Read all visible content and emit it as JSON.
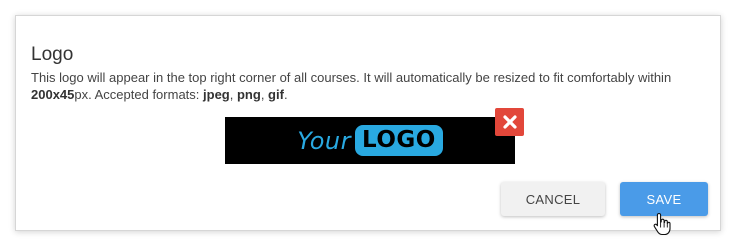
{
  "logo_section": {
    "title": "Logo",
    "description_part1": "This logo will appear in the top right corner of all courses. It will automatically be resized to fit comfortably within ",
    "dimensions": "200x45",
    "description_part2": "px. Accepted formats: ",
    "format_jpeg": "jpeg",
    "sep1": ", ",
    "format_png": "png",
    "sep2": ", ",
    "format_gif": "gif",
    "end": ".",
    "preview": {
      "text_your": "Your",
      "text_logo": "LOGO",
      "accent_color": "#29a9e1",
      "background_color": "#000000"
    },
    "remove_icon": "close-icon"
  },
  "actions": {
    "cancel_label": "CANCEL",
    "save_label": "SAVE",
    "save_color": "#4a9be8",
    "remove_color": "#e2473a"
  },
  "cursor": "hand-pointer-icon"
}
